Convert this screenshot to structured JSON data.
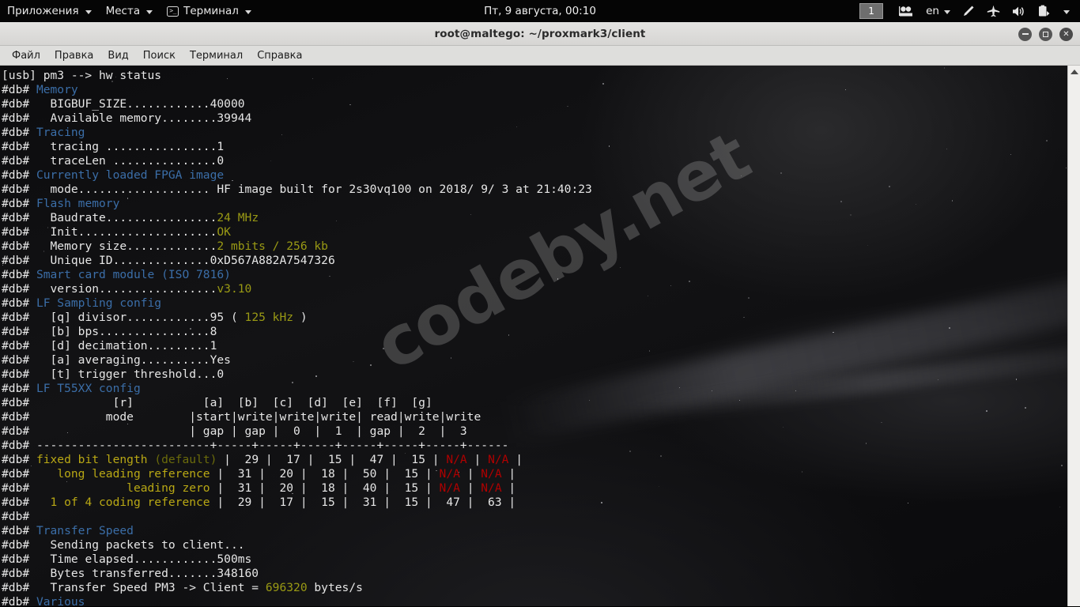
{
  "colors": {
    "header_blue": "#3b6ea8",
    "value_yellow": "#9a9a14",
    "label_yellow": "#b9a814",
    "dim_olive": "#6b6b0b",
    "alert_red": "#b00000",
    "text_white": "#e6e6e6",
    "panel_black": "#050505",
    "titlebar_gray": "#dedddb"
  },
  "top_panel": {
    "menus": [
      {
        "label": "Приложения",
        "icon": "none",
        "caret": true
      },
      {
        "label": "Места",
        "icon": "none",
        "caret": true
      },
      {
        "label": "Терминал",
        "icon": "terminal-icon",
        "caret": true
      }
    ],
    "clock": "Пт, 9 августа, 00:10",
    "workspace": "1",
    "tray": [
      {
        "name": "screencast-icon"
      },
      {
        "name": "language-indicator",
        "label": "en"
      },
      {
        "name": "brightness-pen-icon"
      },
      {
        "name": "airplane-mode-icon"
      },
      {
        "name": "volume-icon"
      },
      {
        "name": "battery-icon"
      },
      {
        "name": "system-menu-caret"
      }
    ]
  },
  "window": {
    "title": "root@maltego: ~/proxmark3/client",
    "buttons": {
      "minimize": "minimize",
      "maximize": "maximize",
      "close": "close"
    },
    "menubar": [
      "Файл",
      "Правка",
      "Вид",
      "Поиск",
      "Терминал",
      "Справка"
    ]
  },
  "watermark": "codeby.net",
  "terminal": {
    "prompt_line": "[usb] pm3 --> hw status",
    "lines": [
      {
        "prefix": "#db# ",
        "segments": [
          {
            "t": "Memory",
            "c": "hdr"
          }
        ]
      },
      {
        "prefix": "#db# ",
        "segments": [
          {
            "t": "  BIGBUF_SIZE............40000",
            "c": "wht"
          }
        ]
      },
      {
        "prefix": "#db# ",
        "segments": [
          {
            "t": "  Available memory........39944",
            "c": "wht"
          }
        ]
      },
      {
        "prefix": "#db# ",
        "segments": [
          {
            "t": "Tracing",
            "c": "hdr"
          }
        ]
      },
      {
        "prefix": "#db# ",
        "segments": [
          {
            "t": "  tracing ................1",
            "c": "wht"
          }
        ]
      },
      {
        "prefix": "#db# ",
        "segments": [
          {
            "t": "  traceLen ...............0",
            "c": "wht"
          }
        ]
      },
      {
        "prefix": "#db# ",
        "segments": [
          {
            "t": "Currently loaded FPGA image",
            "c": "hdr"
          }
        ]
      },
      {
        "prefix": "#db# ",
        "segments": [
          {
            "t": "  mode................... HF image built for 2s30vq100 on 2018/ 9/ 3 at 21:40:23",
            "c": "wht"
          }
        ]
      },
      {
        "prefix": "#db# ",
        "segments": [
          {
            "t": "Flash memory",
            "c": "hdr"
          }
        ]
      },
      {
        "prefix": "#db# ",
        "segments": [
          {
            "t": "  Baudrate................",
            "c": "wht"
          },
          {
            "t": "24 MHz",
            "c": "yel"
          }
        ]
      },
      {
        "prefix": "#db# ",
        "segments": [
          {
            "t": "  Init....................",
            "c": "wht"
          },
          {
            "t": "OK",
            "c": "yel"
          }
        ]
      },
      {
        "prefix": "#db# ",
        "segments": [
          {
            "t": "  Memory size.............",
            "c": "wht"
          },
          {
            "t": "2 mbits / 256 kb",
            "c": "yel"
          }
        ]
      },
      {
        "prefix": "#db# ",
        "segments": [
          {
            "t": "  Unique ID..............0xD567A882A7547326",
            "c": "wht"
          }
        ]
      },
      {
        "prefix": "#db# ",
        "segments": [
          {
            "t": "Smart card module (ISO 7816)",
            "c": "hdr"
          }
        ]
      },
      {
        "prefix": "#db# ",
        "segments": [
          {
            "t": "  version.................",
            "c": "wht"
          },
          {
            "t": "v3.10",
            "c": "yel"
          }
        ]
      },
      {
        "prefix": "#db# ",
        "segments": [
          {
            "t": "LF Sampling config",
            "c": "hdr"
          }
        ]
      },
      {
        "prefix": "#db# ",
        "segments": [
          {
            "t": "  [q] divisor............95 ( ",
            "c": "wht"
          },
          {
            "t": "125 kHz",
            "c": "yel"
          },
          {
            "t": " )",
            "c": "wht"
          }
        ]
      },
      {
        "prefix": "#db# ",
        "segments": [
          {
            "t": "  [b] bps................8",
            "c": "wht"
          }
        ]
      },
      {
        "prefix": "#db# ",
        "segments": [
          {
            "t": "  [d] decimation.........1",
            "c": "wht"
          }
        ]
      },
      {
        "prefix": "#db# ",
        "segments": [
          {
            "t": "  [a] averaging..........Yes",
            "c": "wht"
          }
        ]
      },
      {
        "prefix": "#db# ",
        "segments": [
          {
            "t": "  [t] trigger threshold...0",
            "c": "wht"
          }
        ]
      },
      {
        "prefix": "#db# ",
        "segments": [
          {
            "t": "LF T55XX config",
            "c": "hdr"
          }
        ]
      },
      {
        "prefix": "#db# ",
        "segments": [
          {
            "t": "           [r]          [a]  [b]  [c]  [d]  [e]  [f]  [g]",
            "c": "wht"
          }
        ]
      },
      {
        "prefix": "#db# ",
        "segments": [
          {
            "t": "          mode        |start|write|write|write| read|write|write",
            "c": "wht"
          }
        ]
      },
      {
        "prefix": "#db# ",
        "segments": [
          {
            "t": "                      | gap | gap |  0  |  1  | gap |  2  |  3",
            "c": "wht"
          }
        ]
      },
      {
        "prefix": "#db# ",
        "segments": [
          {
            "t": "-------------------------+-----+-----+-----+-----+-----+-----+------",
            "c": "wht"
          }
        ]
      },
      {
        "prefix": "#db# ",
        "segments": [
          {
            "t": "fixed bit length ",
            "c": "yel2"
          },
          {
            "t": "(default)",
            "c": "dim"
          },
          {
            "t": " |  29 |  17 |  15 |  47 |  15 | ",
            "c": "wht"
          },
          {
            "t": "N/A",
            "c": "red"
          },
          {
            "t": " | ",
            "c": "wht"
          },
          {
            "t": "N/A",
            "c": "red"
          },
          {
            "t": " |",
            "c": "wht"
          }
        ]
      },
      {
        "prefix": "#db# ",
        "segments": [
          {
            "t": "   long leading reference",
            "c": "yel2"
          },
          {
            "t": " |  31 |  20 |  18 |  50 |  15 | ",
            "c": "wht"
          },
          {
            "t": "N/A",
            "c": "red"
          },
          {
            "t": " | ",
            "c": "wht"
          },
          {
            "t": "N/A",
            "c": "red"
          },
          {
            "t": " |",
            "c": "wht"
          }
        ]
      },
      {
        "prefix": "#db# ",
        "segments": [
          {
            "t": "             leading zero",
            "c": "yel2"
          },
          {
            "t": " |  31 |  20 |  18 |  40 |  15 | ",
            "c": "wht"
          },
          {
            "t": "N/A",
            "c": "red"
          },
          {
            "t": " | ",
            "c": "wht"
          },
          {
            "t": "N/A",
            "c": "red"
          },
          {
            "t": " |",
            "c": "wht"
          }
        ]
      },
      {
        "prefix": "#db# ",
        "segments": [
          {
            "t": "  1 of 4 coding reference",
            "c": "yel2"
          },
          {
            "t": " |  29 |  17 |  15 |  31 |  15 |  47 |  63 |",
            "c": "wht"
          }
        ]
      },
      {
        "prefix": "#db# ",
        "segments": [
          {
            "t": "",
            "c": "wht"
          }
        ]
      },
      {
        "prefix": "#db# ",
        "segments": [
          {
            "t": "Transfer Speed",
            "c": "hdr"
          }
        ]
      },
      {
        "prefix": "#db# ",
        "segments": [
          {
            "t": "  Sending packets to client...",
            "c": "wht"
          }
        ]
      },
      {
        "prefix": "#db# ",
        "segments": [
          {
            "t": "  Time elapsed............500ms",
            "c": "wht"
          }
        ]
      },
      {
        "prefix": "#db# ",
        "segments": [
          {
            "t": "  Bytes transferred.......348160",
            "c": "wht"
          }
        ]
      },
      {
        "prefix": "#db# ",
        "segments": [
          {
            "t": "  Transfer Speed PM3 -> Client = ",
            "c": "wht"
          },
          {
            "t": "696320",
            "c": "yel"
          },
          {
            "t": " bytes/s",
            "c": "wht"
          }
        ]
      },
      {
        "prefix": "#db# ",
        "segments": [
          {
            "t": "Various",
            "c": "hdr"
          }
        ]
      }
    ]
  },
  "scrollbar": {
    "up_arrow": "scroll-up-arrow"
  }
}
